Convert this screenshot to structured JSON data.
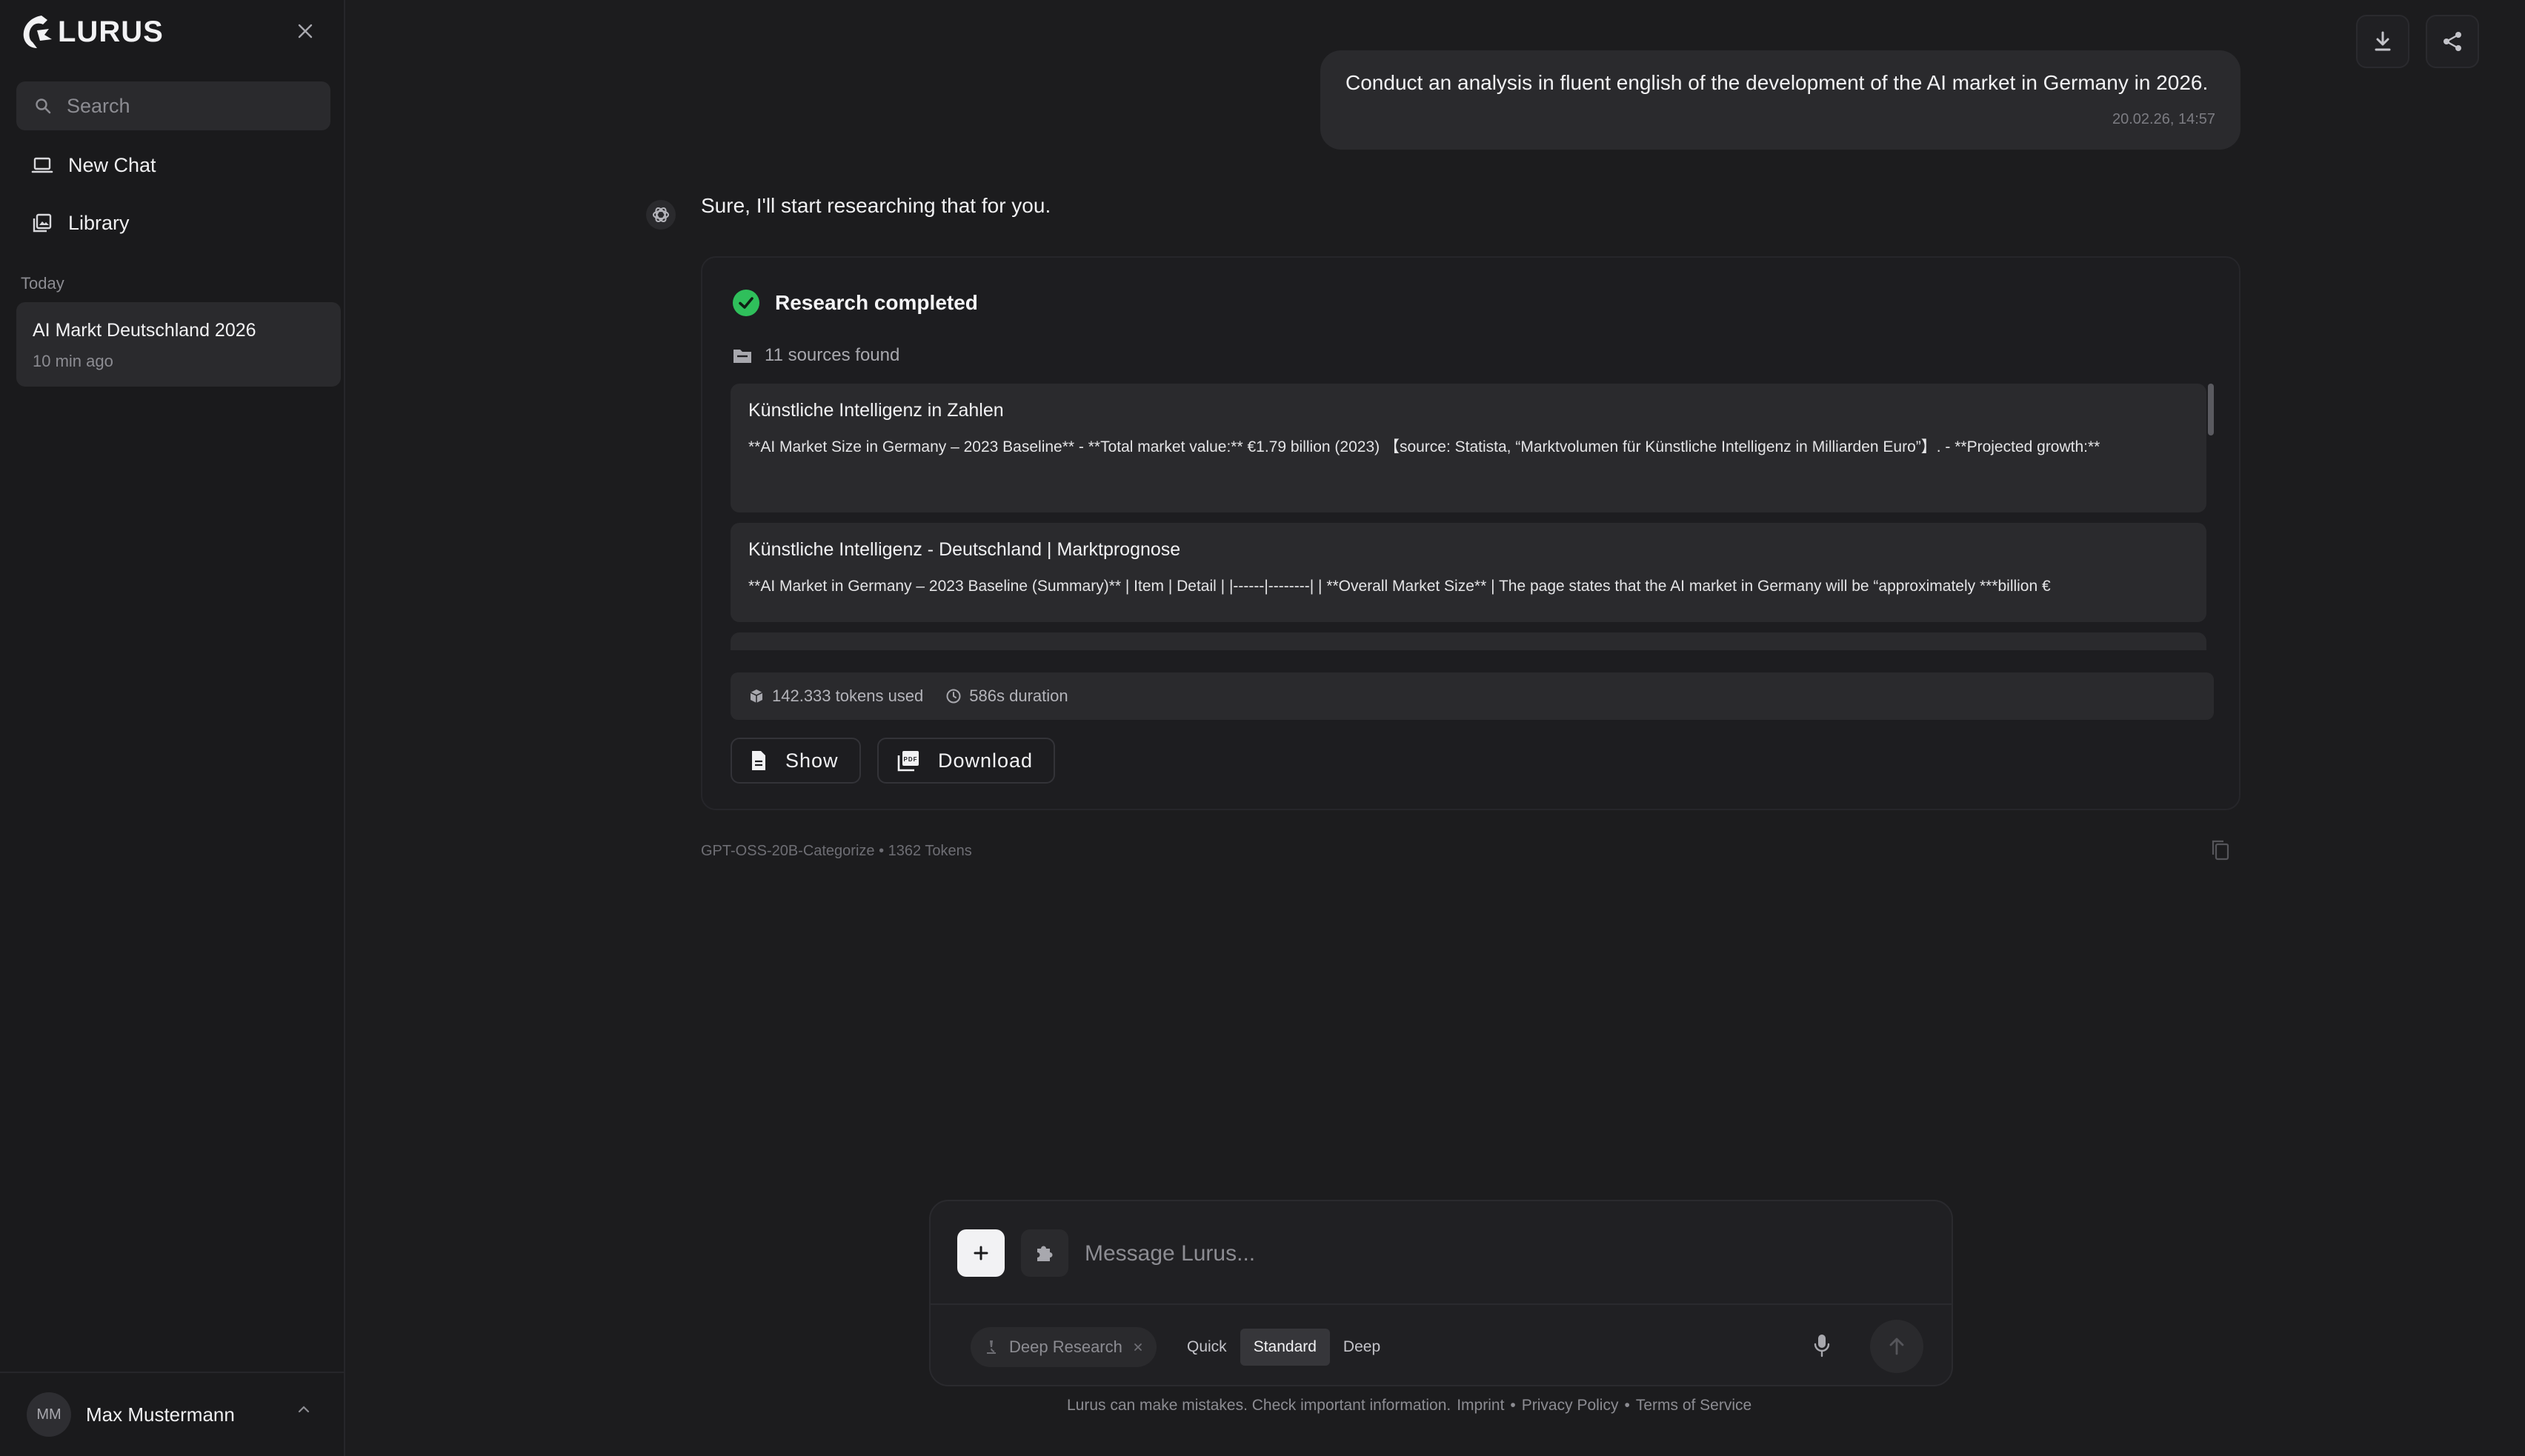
{
  "app": {
    "name": "LURUS"
  },
  "sidebar": {
    "search_placeholder": "Search",
    "items": [
      {
        "label": "New Chat",
        "icon": "laptop-icon"
      },
      {
        "label": "Library",
        "icon": "library-icon"
      }
    ],
    "section_label": "Today",
    "chats": [
      {
        "title": "AI Markt Deutschland 2026",
        "time": "10 min ago"
      }
    ],
    "user": {
      "initials": "MM",
      "name": "Max Mustermann"
    }
  },
  "conversation": {
    "user_message": {
      "text": "Conduct an analysis in fluent english of the development of the AI market in Germany in 2026.",
      "timestamp": "20.02.26, 14:57"
    },
    "assistant_message": "Sure, I'll start researching that for you.",
    "research": {
      "status": "Research completed",
      "sources_found": "11 sources found",
      "sources": [
        {
          "title": "Künstliche Intelligenz in Zahlen",
          "body": "**AI Market Size in Germany – 2023 Baseline** - **Total market value:** €1.79 billion (2023) 【source: Statista, “Marktvolumen für Künstliche Intelligenz in Milliarden Euro”】. - **Projected growth:**"
        },
        {
          "title": "Künstliche Intelligenz - Deutschland | Marktprognose",
          "body": "**AI Market in Germany – 2023 Baseline (Summary)** | Item | Detail | |------|--------| | **Overall Market Size** | The page states that the AI market in Germany will be “approximately ***billion €"
        }
      ],
      "tokens_used": "142.333 tokens used",
      "duration": "586s duration",
      "show_label": "Show",
      "download_label": "Download"
    },
    "meta": "GPT-OSS-20B-Categorize • 1362 Tokens"
  },
  "composer": {
    "placeholder": "Message Lurus...",
    "mode_chip": "Deep Research",
    "depth_options": [
      "Quick",
      "Standard",
      "Deep"
    ],
    "depth_selected": "Standard"
  },
  "footer": {
    "disclaimer": "Lurus can make mistakes. Check important information.",
    "links": [
      "Imprint",
      "Privacy Policy",
      "Terms of Service"
    ],
    "separator": "•"
  },
  "colors": {
    "background": "#1c1c1e",
    "surface": "#2a2a2d",
    "success": "#2fbf5b",
    "text": "#f2f2f4",
    "muted": "#8c8c92"
  }
}
